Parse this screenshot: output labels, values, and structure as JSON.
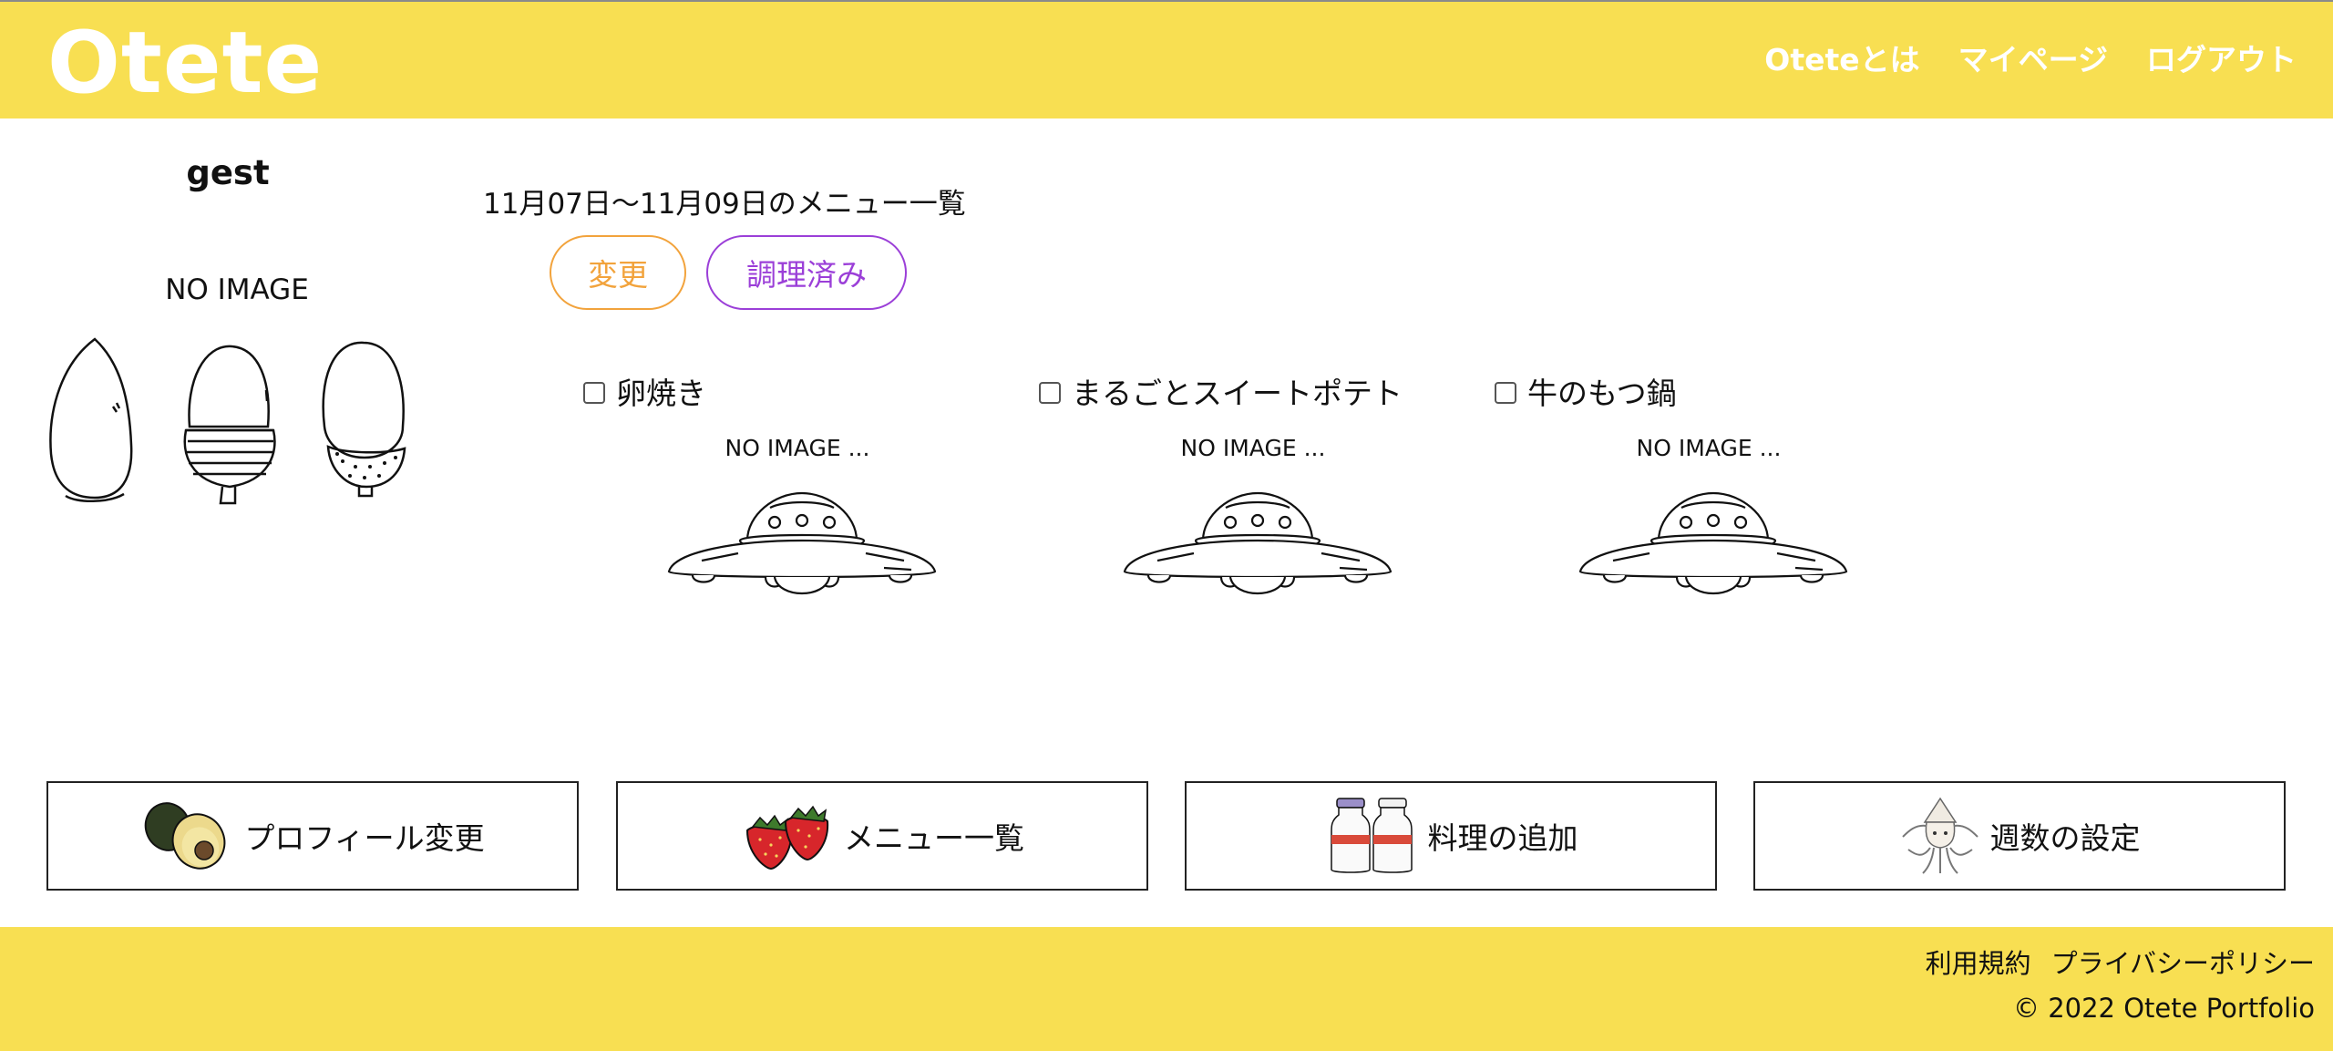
{
  "header": {
    "logo": "Otete",
    "nav": [
      "Oteteとは",
      "マイページ",
      "ログアウト"
    ]
  },
  "profile": {
    "username": "gest",
    "image_placeholder": "NO IMAGE"
  },
  "menu": {
    "period_title": "11月07日〜11月09日のメニュー一覧",
    "change_label": "変更",
    "cooked_label": "調理済み",
    "dishes": [
      {
        "name": "卵焼き",
        "image_placeholder": "NO IMAGE ...",
        "checked": false
      },
      {
        "name": "まるごとスイートポテト",
        "image_placeholder": "NO IMAGE ...",
        "checked": false
      },
      {
        "name": "牛のもつ鍋",
        "image_placeholder": "NO IMAGE ...",
        "checked": false
      }
    ]
  },
  "actions": [
    {
      "label": "プロフィール変更",
      "icon": "avocado-icon"
    },
    {
      "label": "メニュー一覧",
      "icon": "strawberry-icon"
    },
    {
      "label": "料理の追加",
      "icon": "milk-bottle-icon"
    },
    {
      "label": "週数の設定",
      "icon": "squid-icon"
    }
  ],
  "footer": {
    "links": [
      "利用規約",
      "プライバシーポリシー"
    ],
    "copyright": "© 2022 Otete Portfolio"
  },
  "colors": {
    "brand_yellow": "#f8df52",
    "change_orange": "#f2a33c",
    "cooked_purple": "#9b3fd8"
  }
}
